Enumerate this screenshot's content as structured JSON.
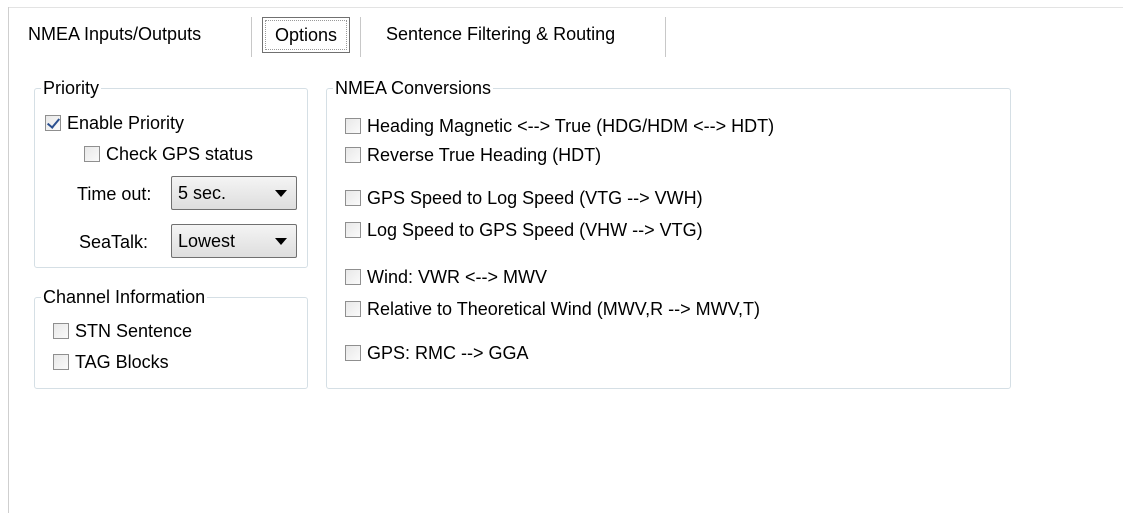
{
  "tabs": {
    "inputs_outputs": "NMEA Inputs/Outputs",
    "options": "Options",
    "filtering_routing": "Sentence Filtering & Routing"
  },
  "priority": {
    "legend": "Priority",
    "enable_priority": {
      "label": "Enable Priority",
      "checked": true
    },
    "check_gps_status": {
      "label": "Check GPS status",
      "checked": false
    },
    "timeout_label": "Time out:",
    "timeout_value": "5 sec.",
    "seatalk_label": "SeaTalk:",
    "seatalk_value": "Lowest"
  },
  "channel_info": {
    "legend": "Channel Information",
    "stn_sentence": {
      "label": "STN Sentence",
      "checked": false
    },
    "tag_blocks": {
      "label": "TAG Blocks",
      "checked": false
    }
  },
  "conversions": {
    "legend": "NMEA Conversions",
    "items": [
      {
        "label": "Heading Magnetic <--> True (HDG/HDM <--> HDT)",
        "checked": false
      },
      {
        "label": "Reverse True Heading (HDT)",
        "checked": false
      },
      {
        "label": "GPS Speed to Log Speed (VTG --> VWH)",
        "checked": false
      },
      {
        "label": "Log Speed to GPS Speed (VHW --> VTG)",
        "checked": false
      },
      {
        "label": "Wind: VWR <--> MWV",
        "checked": false
      },
      {
        "label": "Relative to Theoretical Wind (MWV,R --> MWV,T)",
        "checked": false
      },
      {
        "label": "GPS: RMC --> GGA",
        "checked": false
      }
    ]
  },
  "icons": {
    "dropdown": "chevron-down-icon",
    "check": "checkmark-icon"
  }
}
